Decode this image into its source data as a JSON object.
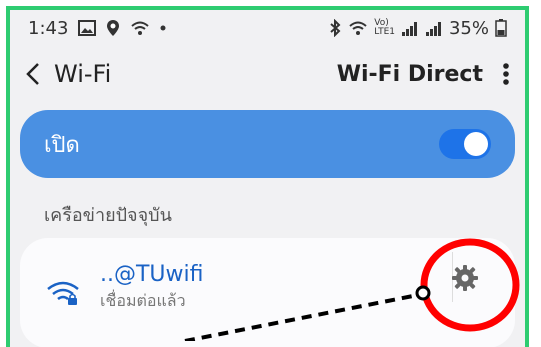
{
  "status_bar": {
    "time": "1:43",
    "battery_percent": "35%",
    "network_label": "LTE1",
    "vo_label": "Vo)"
  },
  "app_bar": {
    "title": "Wi-Fi",
    "action_label": "Wi-Fi Direct"
  },
  "wifi_toggle": {
    "label": "เปิด",
    "enabled": true
  },
  "section": {
    "current_network_title": "เครือข่ายปัจจุบัน"
  },
  "network": {
    "name": "..@TUwifi",
    "status": "เชื่อมต่อแล้ว"
  },
  "colors": {
    "frame": "#2ecc71",
    "toggle_card": "#4a90e2",
    "switch_on": "#1e73e8",
    "annotation": "#ff0000"
  }
}
